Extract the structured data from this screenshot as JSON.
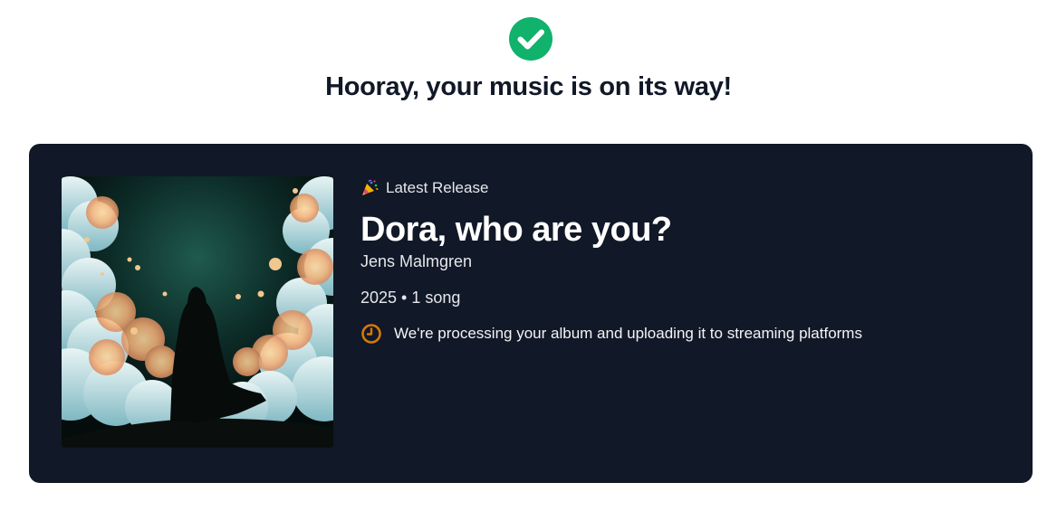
{
  "header": {
    "icon": "check-circle-icon",
    "success_color": "#10b26c",
    "headline": "Hooray, your music is on its way!"
  },
  "release": {
    "badge_icon": "party-popper-icon",
    "badge_label": "Latest Release",
    "title": "Dora, who are you?",
    "artist": "Jens Malmgren",
    "meta": "2025 • 1 song",
    "status_icon": "clock-icon",
    "status_color": "#d97706",
    "status_text": "We're processing your album and uploading it to streaming platforms",
    "cover_alt": "album-cover"
  },
  "colors": {
    "card_bg": "#111827",
    "page_bg": "#ffffff"
  }
}
